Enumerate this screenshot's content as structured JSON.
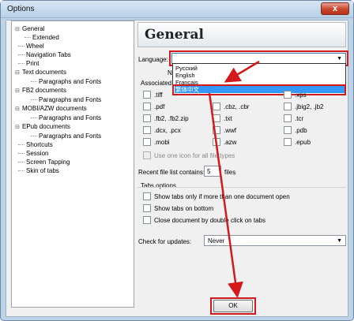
{
  "window": {
    "title": "Options",
    "close_glyph": "x"
  },
  "tree": [
    {
      "label": "General",
      "expander": "⊟"
    },
    {
      "label": "Extended",
      "expander": ""
    },
    {
      "label": "Wheel",
      "expander": ""
    },
    {
      "label": "Navigation Tabs",
      "expander": ""
    },
    {
      "label": "Print",
      "expander": ""
    },
    {
      "label": "Text documents",
      "expander": "⊟"
    },
    {
      "label": "Paragraphs and Fonts",
      "expander": ""
    },
    {
      "label": "FB2 documents",
      "expander": "⊟"
    },
    {
      "label": "Paragraphs and Fonts",
      "expander": ""
    },
    {
      "label": "MOBI/AZW documents",
      "expander": "⊟"
    },
    {
      "label": "Paragraphs and Fonts",
      "expander": ""
    },
    {
      "label": "EPub documents",
      "expander": "⊟"
    },
    {
      "label": "Paragraphs and Fonts",
      "expander": ""
    },
    {
      "label": "Shortcuts",
      "expander": ""
    },
    {
      "label": "Session",
      "expander": ""
    },
    {
      "label": "Screen Tapping",
      "expander": ""
    },
    {
      "label": "Skin of tabs",
      "expander": ""
    }
  ],
  "general": {
    "header": "General",
    "language_label": "Language:",
    "language_value": "",
    "language_options": [
      "Русский",
      "English",
      "Français",
      "繁体中文"
    ],
    "selected_option": "繁体中文",
    "partial_no": "No",
    "partial_associated": "Associated",
    "ext_tiff": ".tiff",
    "ext_xps": ".xps",
    "file_types": [
      [
        ".pdf",
        ".cbz, .cbr",
        ".jbig2, .jb2"
      ],
      [
        ".fb2, .fb2.zip",
        ".txt",
        ".tcr"
      ],
      [
        ".dcx, .pcx",
        ".wwf",
        ".pdb"
      ],
      [
        ".mobi",
        ".azw",
        ".epub"
      ]
    ],
    "use_one_icon": "Use one icon for all file types",
    "recent_label": "Recent file list contains:",
    "recent_value": "5",
    "recent_unit": "files",
    "tabs_options_title": "Tabs options",
    "tab_checks": [
      "Show tabs only if more than one document open",
      "Show tabs on bottom",
      "Close document by double click on tabs"
    ],
    "updates_label": "Check for updates:",
    "updates_value": "Never",
    "ok_label": "OK"
  },
  "colors": {
    "annotation_red": "#d3191c",
    "selection_blue": "#3399ff"
  }
}
